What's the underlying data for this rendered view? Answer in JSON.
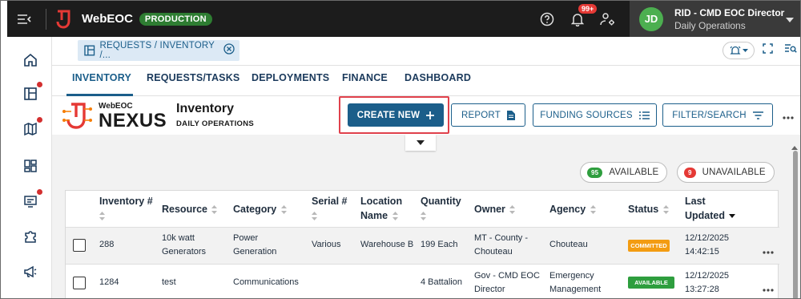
{
  "topbar": {
    "app_title": "WebEOC",
    "env_badge": "PRODUCTION",
    "notification_count": "99+",
    "user_initials": "JD",
    "user_name": "RID - CMD EOC Director",
    "user_role": "Daily Operations"
  },
  "sidebar": {
    "items": [
      {
        "icon": "home-icon",
        "dot": false
      },
      {
        "icon": "board-icon",
        "dot": true
      },
      {
        "icon": "map-icon",
        "dot": true
      },
      {
        "icon": "dashboard-grid-icon",
        "dot": false
      },
      {
        "icon": "message-monitor-icon",
        "dot": true
      },
      {
        "icon": "plugin-puzzle-icon",
        "dot": false
      },
      {
        "icon": "megaphone-icon",
        "dot": false
      }
    ]
  },
  "tabstrip": {
    "open_board": "REQUESTS / INVENTORY /..."
  },
  "nav": {
    "tabs": [
      "INVENTORY",
      "REQUESTS/TASKS",
      "DEPLOYMENTS",
      "FINANCE",
      "DASHBOARD"
    ],
    "active": "INVENTORY"
  },
  "header": {
    "logo_small": "WebEOC",
    "logo_big": "NEXUS",
    "title": "Inventory",
    "subtitle": "DAILY OPERATIONS",
    "create_new": "CREATE NEW",
    "report": "REPORT",
    "funding_sources": "FUNDING SOURCES",
    "filter_search": "FILTER/SEARCH"
  },
  "availability": {
    "available_count": "95",
    "available_label": "AVAILABLE",
    "unavailable_count": "9",
    "unavailable_label": "UNAVAILABLE"
  },
  "table": {
    "columns": {
      "inventory": "Inventory #",
      "resource": "Resource",
      "category": "Category",
      "serial": "Serial #",
      "location_1": "Location",
      "location_2": "Name",
      "quantity": "Quantity",
      "owner": "Owner",
      "agency": "Agency",
      "status": "Status",
      "updated_1": "Last",
      "updated_2": "Updated"
    },
    "rows": [
      {
        "inventory": "288",
        "resource_1": "10k watt",
        "resource_2": "Generators",
        "category_1": "Power",
        "category_2": "Generation",
        "serial": "Various",
        "location": "Warehouse B",
        "quantity": "199 Each",
        "owner_1": "MT - County -",
        "owner_2": "Chouteau",
        "agency_1": "Chouteau",
        "agency_2": "",
        "status": "COMMITTED",
        "date": "12/12/2025",
        "time": "14:42:15"
      },
      {
        "inventory": "1284",
        "resource_1": "test",
        "resource_2": "",
        "category_1": "Communications",
        "category_2": "",
        "serial": "",
        "location": "",
        "quantity": "4 Battalion",
        "owner_1": "Gov - CMD EOC",
        "owner_2": "Director",
        "agency_1": "Emergency",
        "agency_2": "Management",
        "status": "AVAILABLE",
        "date": "12/12/2025",
        "time": "13:27:28"
      }
    ]
  },
  "colors": {
    "primary": "#1b5e8a",
    "committed": "#f39c12",
    "available": "#2e9e3e",
    "unavailable": "#e53935",
    "highlight": "#e0414c"
  }
}
